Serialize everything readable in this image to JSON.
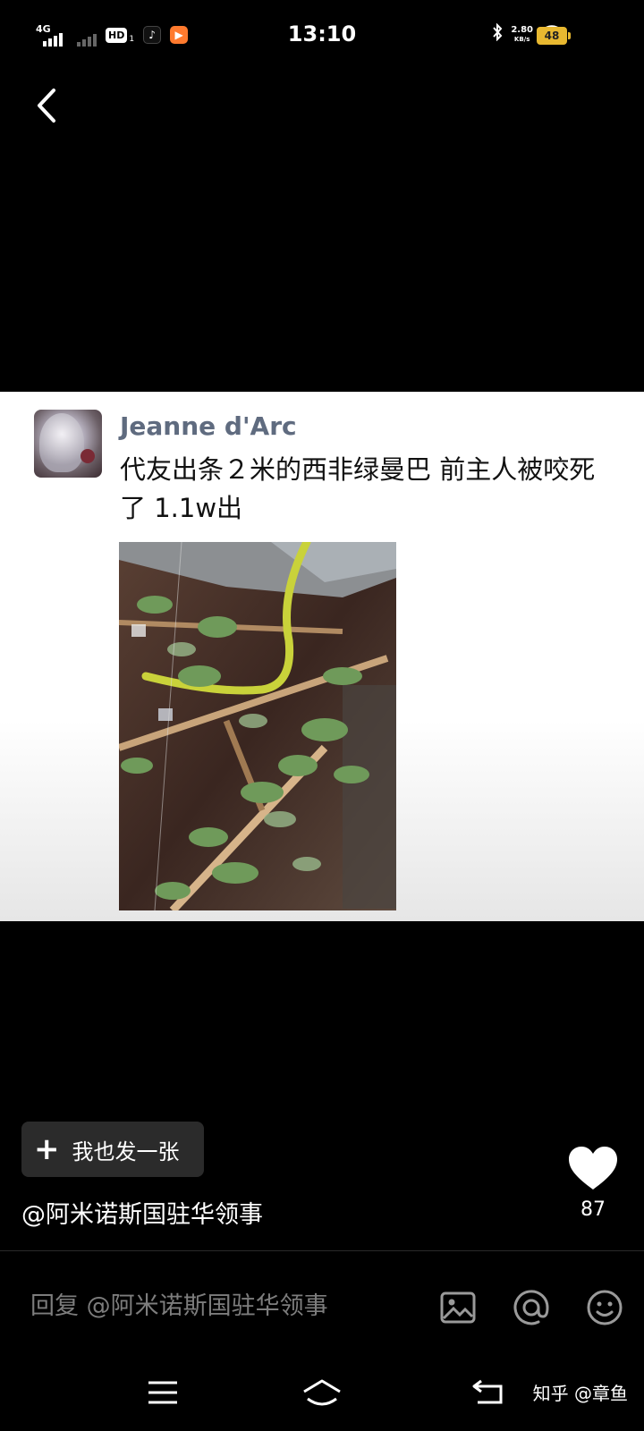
{
  "status_bar": {
    "network": "4G",
    "hd": "HD",
    "hd_sub": "1",
    "time": "13:10",
    "speed_value": "2.80",
    "speed_unit": "KB/s",
    "battery": "48"
  },
  "post": {
    "username": "Jeanne d'Arc",
    "text": "代友出条２米的西非绿曼巴 前主人被咬死了 1.1w出"
  },
  "actions": {
    "post_button_label": "我也发一张",
    "mention": "@阿米诺斯国驻华领事",
    "like_count": "87"
  },
  "reply": {
    "placeholder": "回复 @阿米诺斯国驻华领事"
  },
  "watermark": "知乎 @章鱼",
  "colors": {
    "background": "#000000",
    "card": "#ffffff",
    "username": "#5f6b7f",
    "battery": "#e8b830",
    "button": "#2b2b2b"
  }
}
